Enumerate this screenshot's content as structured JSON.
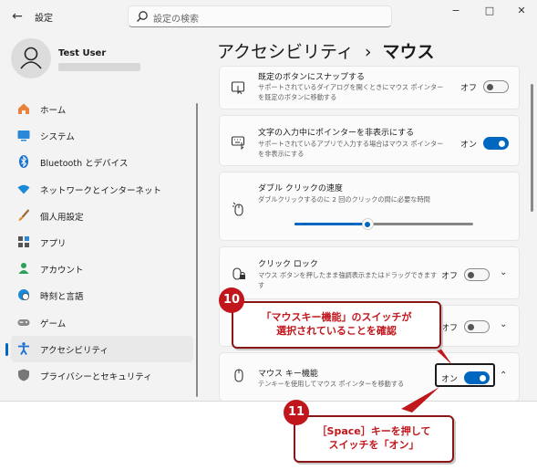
{
  "window": {
    "title": "設定",
    "search_placeholder": "設定の検索",
    "controls": [
      "−",
      "□",
      "✕"
    ]
  },
  "profile": {
    "name": "Test User"
  },
  "sidebar": {
    "items": [
      {
        "label": "ホーム",
        "icon": "home-icon"
      },
      {
        "label": "システム",
        "icon": "system-icon"
      },
      {
        "label": "Bluetooth とデバイス",
        "icon": "bluetooth-icon"
      },
      {
        "label": "ネットワークとインターネット",
        "icon": "wifi-icon"
      },
      {
        "label": "個人用設定",
        "icon": "brush-icon"
      },
      {
        "label": "アプリ",
        "icon": "apps-icon"
      },
      {
        "label": "アカウント",
        "icon": "account-icon"
      },
      {
        "label": "時刻と言語",
        "icon": "globe-clock-icon"
      },
      {
        "label": "ゲーム",
        "icon": "gamepad-icon"
      },
      {
        "label": "アクセシビリティ",
        "icon": "accessibility-icon",
        "selected": true
      },
      {
        "label": "プライバシーとセキュリティ",
        "icon": "shield-icon"
      }
    ]
  },
  "header": {
    "parent": "アクセシビリティ",
    "separator": "›",
    "current": "マウス"
  },
  "settings": {
    "snap": {
      "title": "既定のボタンにスナップする",
      "desc": "サポートされているダイアログを開くときにマウス ポインターを既定のボタンに移動する",
      "state": "オフ"
    },
    "hide_pointer": {
      "title": "文字の入力中にポインターを非表示にする",
      "desc": "サポートされているアプリで入力する場合はマウス ポインターを非表示にする",
      "state": "オン"
    },
    "double_click": {
      "title": "ダブル クリックの速度",
      "desc": "ダブルクリックするのに 2 回のクリックの間に必要な時間",
      "slider_fraction": 0.41
    },
    "click_lock": {
      "title": "クリック ロック",
      "desc": "マウス ボタンを押したまま強調表示またはドラッグできます",
      "desc_tail": "す",
      "state": "オフ"
    },
    "hidden_row": {
      "state": "オフ"
    },
    "mouse_keys": {
      "title": "マウス キー機能",
      "desc": "テンキーを使用してマウス ポインターを移動する",
      "state": "オン"
    }
  },
  "annotations": {
    "step10": {
      "number": "10",
      "line1": "「マウスキー機能」のスイッチが",
      "line2": "選択されていることを確認"
    },
    "step11": {
      "number": "11",
      "line1": "［Space］キーを押して",
      "line2": "スイッチを「オン」"
    }
  },
  "colors": {
    "accent": "#0067c0",
    "callout_red": "#c0161c"
  }
}
